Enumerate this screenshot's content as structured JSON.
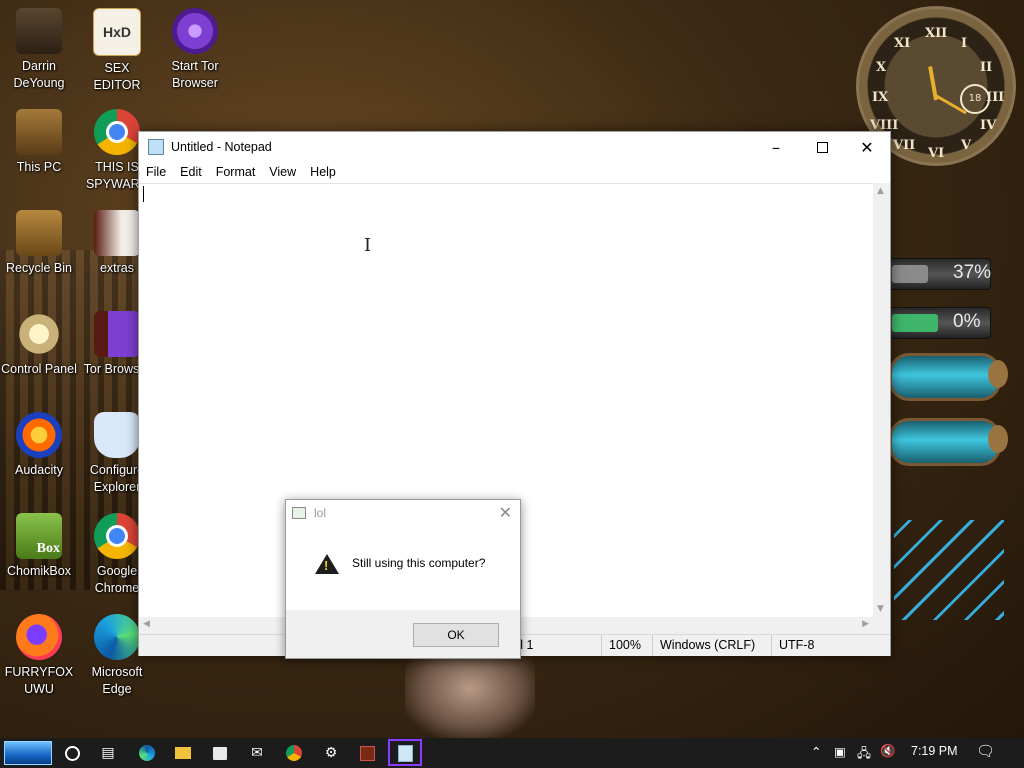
{
  "desktop": {
    "icons": [
      {
        "label": "Darrin\nDeYoung"
      },
      {
        "label": "SEX\nEDITOR"
      },
      {
        "label": "Start Tor\nBrowser"
      },
      {
        "label": "This PC"
      },
      {
        "label": "THIS IS\nSPYWARE"
      },
      {
        "label": "Recycle Bin"
      },
      {
        "label": "extras"
      },
      {
        "label": "Control Panel"
      },
      {
        "label": "Tor Browser"
      },
      {
        "label": "Audacity"
      },
      {
        "label": "Configure\nExplorer"
      },
      {
        "label": "ChomikBox"
      },
      {
        "label": "Google\nChrome"
      },
      {
        "label": "FURRYFOX\nUWU"
      },
      {
        "label": "Microsoft\nEdge"
      }
    ],
    "hxd_logo": "HxD",
    "chomik_logo": "Box"
  },
  "widgets": {
    "clock": {
      "numerals": [
        "XII",
        "I",
        "II",
        "III",
        "IV",
        "V",
        "VI",
        "VII",
        "VIII",
        "IX",
        "X",
        "XI"
      ],
      "inner_dial": "18"
    },
    "cpu_percent": "37%",
    "cpu_level": 0.37,
    "ram_percent": "0%",
    "ram_level": 0.0
  },
  "notepad": {
    "title": "Untitled - Notepad",
    "menu": [
      "File",
      "Edit",
      "Format",
      "View",
      "Help"
    ],
    "content": "",
    "status": {
      "position": "Ln 1, Col 1",
      "zoom": "100%",
      "line_endings": "Windows (CRLF)",
      "encoding": "UTF-8"
    }
  },
  "dialog": {
    "title": "lol",
    "message": "Still using this computer?",
    "ok_label": "OK"
  },
  "taskbar": {
    "clock": "7:19 PM"
  },
  "colors": {
    "taskbar": "#1c1c1c",
    "active_app_outline": "#8b3cff",
    "window_bg": "#ffffff",
    "statusbar_bg": "#f0f0f0"
  }
}
